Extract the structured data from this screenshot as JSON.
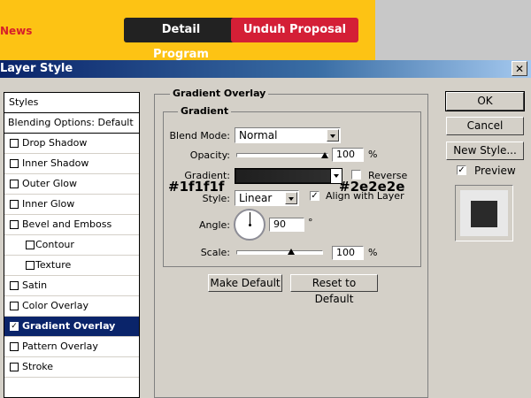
{
  "website": {
    "news_label": "News",
    "detail_button": "Detail Program",
    "unduh_button": "Unduh Proposal",
    "colors": {
      "bar": "#fdc314",
      "detail": "#222222",
      "unduh": "#d41f36"
    }
  },
  "window": {
    "title": "Layer Style",
    "close_glyph": "✕"
  },
  "styles_panel": {
    "header": "Styles",
    "blending": "Blending Options: Default",
    "items": [
      {
        "label": "Drop Shadow",
        "checked": false
      },
      {
        "label": "Inner Shadow",
        "checked": false
      },
      {
        "label": "Outer Glow",
        "checked": false
      },
      {
        "label": "Inner Glow",
        "checked": false
      },
      {
        "label": "Bevel and Emboss",
        "checked": false
      },
      {
        "label": "Contour",
        "checked": false
      },
      {
        "label": "Texture",
        "checked": false
      },
      {
        "label": "Satin",
        "checked": false
      },
      {
        "label": "Color Overlay",
        "checked": false
      },
      {
        "label": "Gradient Overlay",
        "checked": true
      },
      {
        "label": "Pattern Overlay",
        "checked": false
      },
      {
        "label": "Stroke",
        "checked": false
      }
    ],
    "selected": "Gradient Overlay"
  },
  "gradient_overlay": {
    "group_title": "Gradient Overlay",
    "subgroup_title": "Gradient",
    "blend_mode_label": "Blend Mode:",
    "blend_mode_value": "Normal",
    "opacity_label": "Opacity:",
    "opacity_value": "100",
    "opacity_unit": "%",
    "opacity_level": 1.0,
    "gradient_label": "Gradient:",
    "gradient_start_color": "#1f1f1f",
    "gradient_end_color": "#2e2e2e",
    "gradient_start_note": "#1f1f1f",
    "gradient_end_note": "#2e2e2e",
    "reverse_label": "Reverse",
    "reverse_checked": false,
    "style_label": "Style:",
    "style_value": "Linear",
    "align_label": "Align with Layer",
    "align_checked": true,
    "checkmark": "✓",
    "angle_label": "Angle:",
    "angle_value": "90",
    "angle_unit": "°",
    "scale_label": "Scale:",
    "scale_value": "100",
    "scale_unit": "%",
    "scale_level": 0.5,
    "make_default": "Make Default",
    "reset_default": "Reset to Default"
  },
  "side_buttons": {
    "ok": "OK",
    "cancel": "Cancel",
    "new_style": "New Style...",
    "preview_label": "Preview",
    "preview_checked": true,
    "preview_swatch_color": "#2a2a2a"
  }
}
